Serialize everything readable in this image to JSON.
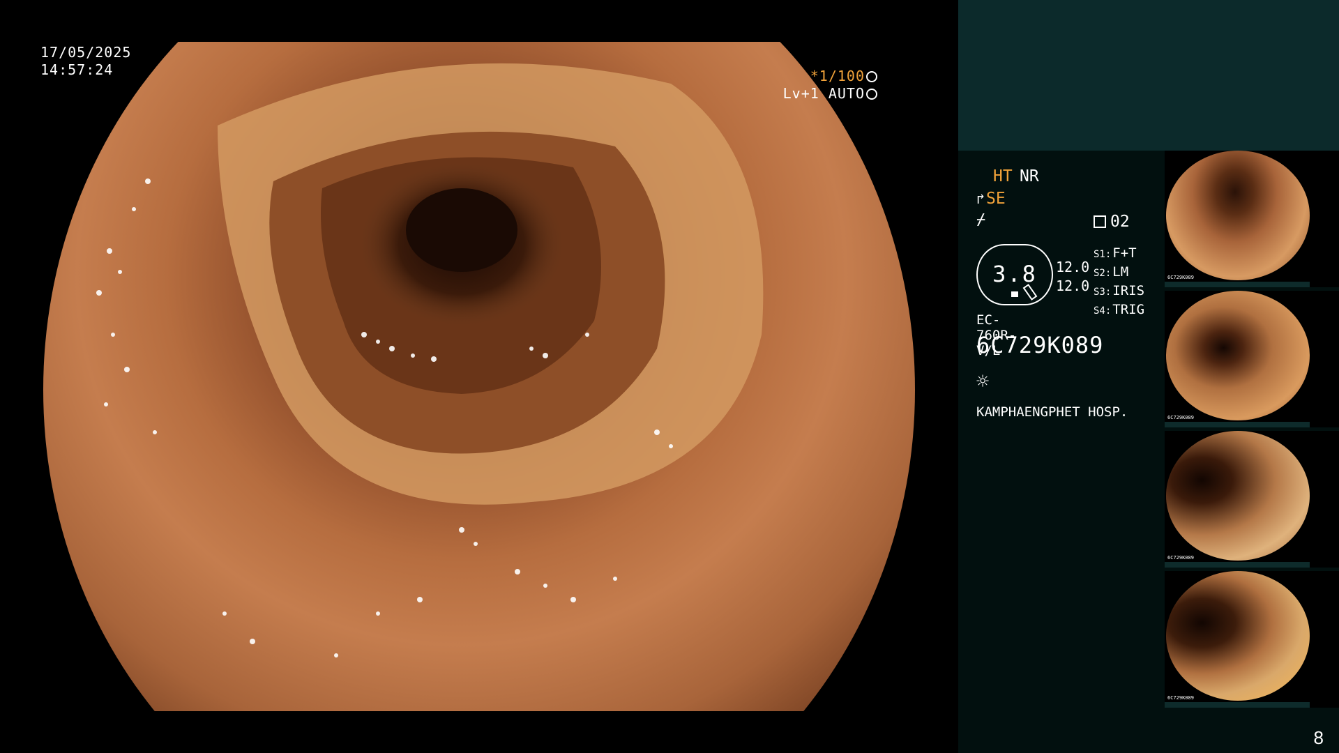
{
  "overlay": {
    "date": "17/05/2025",
    "time": "14:57:24",
    "shutter": "*1/100",
    "enhance": "Lv+1 AUTO"
  },
  "panel": {
    "mode_ht": "HT",
    "mode_nr": "NR",
    "mode_se": "SE",
    "counter": "02",
    "zoom": "3.8",
    "value_1": "12.0",
    "value_2": "12.0",
    "switches": [
      {
        "key": "S1:",
        "value": "F+T"
      },
      {
        "key": "S2:",
        "value": "LM"
      },
      {
        "key": "S3:",
        "value": "IRIS"
      },
      {
        "key": "S4:",
        "value": "TRIG"
      }
    ],
    "scope_model": "EC-760R-V/L",
    "serial": "6C729K089",
    "hospital": "KAMPHAENGPHET HOSP.",
    "page_number": "8"
  },
  "thumbnails": [
    {
      "label": "6C729K089"
    },
    {
      "label": "6C729K089"
    },
    {
      "label": "6C729K089"
    },
    {
      "label": "6C729K089"
    }
  ],
  "icons": {
    "shutter": "aperture-icon",
    "enhance": "gear-icon",
    "se": "scope-icon",
    "freeze": "freeze-icon",
    "counter": "memory-icon",
    "light": "sun-icon"
  }
}
